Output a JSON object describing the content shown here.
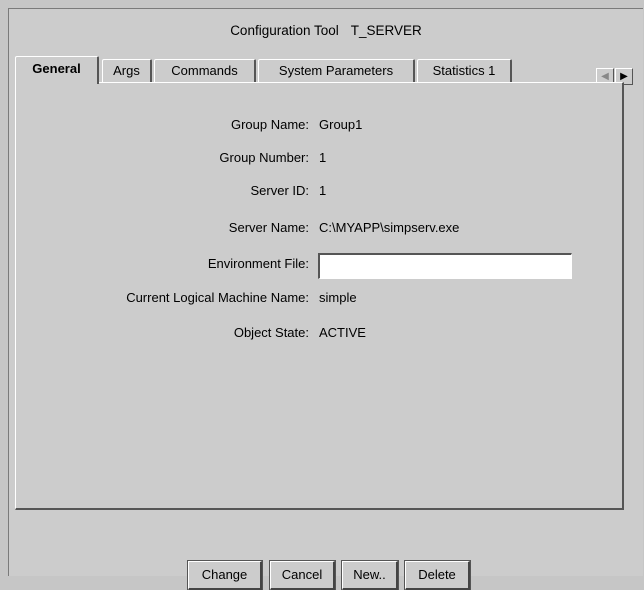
{
  "window": {
    "title_tool": "Configuration Tool",
    "title_object": "T_SERVER"
  },
  "tabs": [
    {
      "label": "General",
      "active": true
    },
    {
      "label": "Args",
      "active": false
    },
    {
      "label": "Commands",
      "active": false
    },
    {
      "label": "System Parameters",
      "active": false
    },
    {
      "label": "Statistics 1",
      "active": false
    }
  ],
  "tab_scroll": {
    "left_icon": "arrow-left-icon",
    "right_icon": "arrow-right-icon",
    "left_glyph": "◀",
    "right_glyph": "▶"
  },
  "general": {
    "group_name": {
      "label": "Group Name:",
      "value": "Group1"
    },
    "group_number": {
      "label": "Group Number:",
      "value": "1"
    },
    "server_id": {
      "label": "Server ID:",
      "value": "1"
    },
    "server_name": {
      "label": "Server Name:",
      "value": "C:\\MYAPP\\simpserv.exe"
    },
    "environment_file": {
      "label": "Environment File:",
      "value": "",
      "placeholder": ""
    },
    "machine_name": {
      "label": "Current Logical Machine Name:",
      "value": "simple"
    },
    "object_state": {
      "label": "Object State:",
      "value": "ACTIVE"
    }
  },
  "buttons": {
    "change": "Change",
    "cancel": "Cancel",
    "new": "New..",
    "delete": "Delete"
  },
  "colors": {
    "window_bg": "#cccccc",
    "shadow": "#555555",
    "highlight": "#ffffff",
    "input_bg": "#ffffff"
  }
}
